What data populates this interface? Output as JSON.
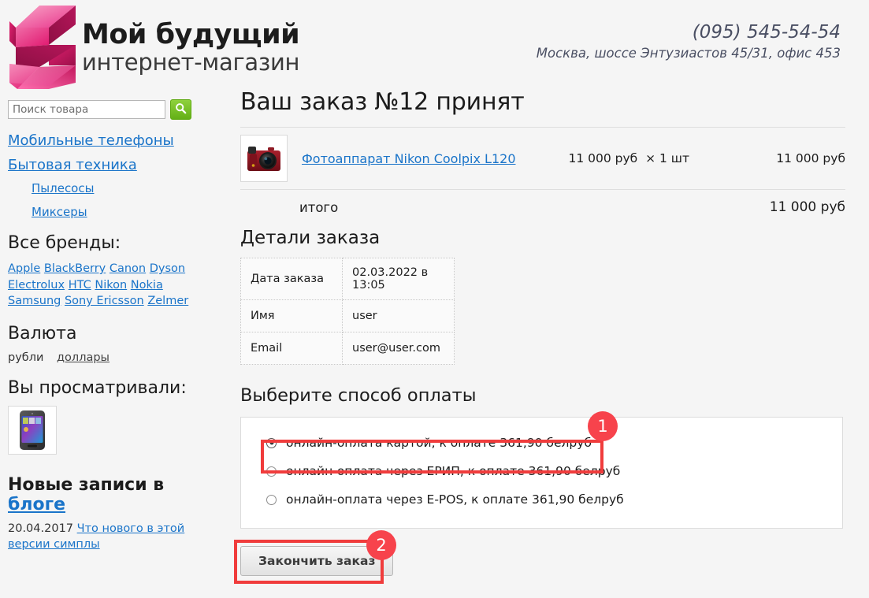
{
  "site": {
    "logo_line1": "Мой будущий",
    "logo_line2": "интернет-магазин",
    "logo_icon": "s-logo-icon",
    "phone": "(095) 545-54-54",
    "address": "Москва, шоссе Энтузиастов 45/31, офис 453"
  },
  "search": {
    "placeholder": "Поиск товара",
    "value": "",
    "button_icon": "search-icon"
  },
  "sidebar": {
    "nav": [
      {
        "label": "Мобильные телефоны",
        "level": 1
      },
      {
        "label": "Бытовая техника",
        "level": 1
      },
      {
        "label": "Пылесосы",
        "level": 2
      },
      {
        "label": "Миксеры",
        "level": 2
      }
    ],
    "brands_heading": "Все бренды:",
    "brands": [
      "Apple",
      "BlackBerry",
      "Canon",
      "Dyson",
      "Electrolux",
      "HTC",
      "Nikon",
      "Nokia",
      "Samsung",
      "Sony Ericsson",
      "Zelmer"
    ],
    "currency_heading": "Валюта",
    "currency_active": "рубли",
    "currency_other": "доллары",
    "viewed_heading": "Вы просматривали:",
    "viewed_item_alt": "phone-thumbnail",
    "blog_heading_prefix": "Новые записи в ",
    "blog_heading_link": "блоге",
    "blog_entry_date": "20.04.2017",
    "blog_entry_title": "Что нового в этой версии симплы"
  },
  "order": {
    "title": "Ваш заказ №12 принят",
    "item": {
      "thumb_alt": "camera-thumbnail",
      "name": "Фотоаппарат Nikon Coolpix L120",
      "unit_price": "11 000 руб",
      "quantity": "× 1 шт",
      "line_total": "11 000 руб"
    },
    "total_label": "итого",
    "total_value": "11 000 руб",
    "details_heading": "Детали заказа",
    "details": [
      {
        "key": "Дата заказа",
        "value": "02.03.2022 в 13:05"
      },
      {
        "key": "Имя",
        "value": "user"
      },
      {
        "key": "Email",
        "value": "user@user.com"
      }
    ]
  },
  "payment": {
    "heading": "Выберите способ оплаты",
    "options": [
      {
        "label": "онлайн-оплата картой, к оплате 361,90 белруб",
        "selected": true
      },
      {
        "label": "онлайн-оплата через ЕРИП, к оплате 361,90 белруб",
        "selected": false
      },
      {
        "label": "онлайн-оплата через E-POS, к оплате 361,90 белруб",
        "selected": false
      }
    ],
    "finish_button": "Закончить заказ"
  },
  "annotations": {
    "badge_1": "1",
    "badge_2": "2"
  },
  "colors": {
    "link": "#1a74c9",
    "annotation_red": "#f7434c",
    "highlight_border": "#f03c3c",
    "logo_pink": "#e81f76",
    "search_button_green": "#7cc62a",
    "page_background": "#f5f5f5"
  }
}
